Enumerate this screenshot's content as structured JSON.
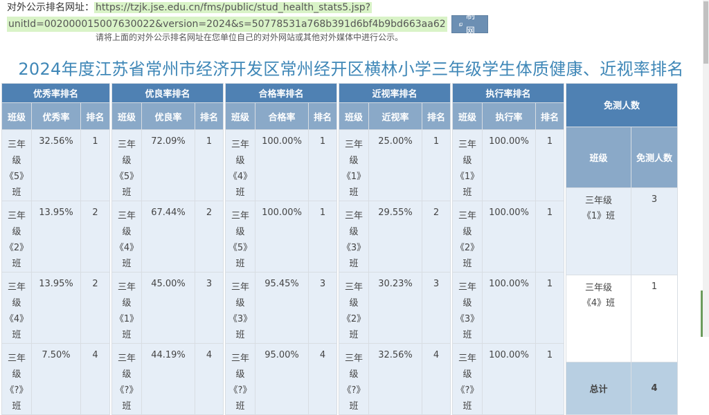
{
  "url_label": "对外公示排名网址：",
  "url_part1": "https://tzjk.jse.edu.cn/fms/public/stud_health_stats5.jsp?",
  "url_part2": "unitId=002000015007630022&version=2024&s=50778531a768b391d6bf4b9bd663aa62",
  "copy_button": "复制网址",
  "hint": "请将上面的对外公示排名网址在您单位自己的对外网站或其他对外媒体中进行公示。",
  "title": "2024年度江苏省常州市经济开发区常州经开区横林小学三年级学生体质健康、近视率排名",
  "colors": {
    "group_header": "#4f81b3",
    "sub_header": "#8aa9c8",
    "cell_bg": "#e6eef7",
    "title": "#3f87b7"
  },
  "tables": [
    {
      "header": "优秀率排名",
      "columns": [
        "班级",
        "优秀率",
        "排名"
      ],
      "rows": [
        {
          "cls": [
            "三年",
            "级",
            "《5》",
            "班"
          ],
          "value": "32.56%",
          "rank": "1"
        },
        {
          "cls": [
            "三年",
            "级",
            "《2》",
            "班"
          ],
          "value": "13.95%",
          "rank": "2"
        },
        {
          "cls": [
            "三年",
            "级",
            "《4》",
            "班"
          ],
          "value": "13.95%",
          "rank": "2"
        },
        {
          "cls": [
            "三年",
            "级",
            "《?》",
            "班"
          ],
          "value": "7.50%",
          "rank": "4"
        }
      ]
    },
    {
      "header": "优良率排名",
      "columns": [
        "班级",
        "优良率",
        "排名"
      ],
      "rows": [
        {
          "cls": [
            "三年",
            "级",
            "《5》",
            "班"
          ],
          "value": "72.09%",
          "rank": "1"
        },
        {
          "cls": [
            "三年",
            "级",
            "《4》",
            "班"
          ],
          "value": "67.44%",
          "rank": "2"
        },
        {
          "cls": [
            "三年",
            "级",
            "《1》",
            "班"
          ],
          "value": "45.00%",
          "rank": "3"
        },
        {
          "cls": [
            "三年",
            "级",
            "《?》",
            "班"
          ],
          "value": "44.19%",
          "rank": "4"
        }
      ]
    },
    {
      "header": "合格率排名",
      "columns": [
        "班级",
        "合格率",
        "排名"
      ],
      "rows": [
        {
          "cls": [
            "三年",
            "级",
            "《4》",
            "班"
          ],
          "value": "100.00%",
          "rank": "1"
        },
        {
          "cls": [
            "三年",
            "级",
            "《5》",
            "班"
          ],
          "value": "100.00%",
          "rank": "1"
        },
        {
          "cls": [
            "三年",
            "级",
            "《3》",
            "班"
          ],
          "value": "95.45%",
          "rank": "3"
        },
        {
          "cls": [
            "三年",
            "级",
            "《?》",
            "班"
          ],
          "value": "95.00%",
          "rank": "4"
        }
      ]
    },
    {
      "header": "近视率排名",
      "columns": [
        "班级",
        "近视率",
        "排名"
      ],
      "rows": [
        {
          "cls": [
            "三年",
            "级",
            "《1》",
            "班"
          ],
          "value": "25.00%",
          "rank": "1"
        },
        {
          "cls": [
            "三年",
            "级",
            "《3》",
            "班"
          ],
          "value": "29.55%",
          "rank": "2"
        },
        {
          "cls": [
            "三年",
            "级",
            "《2》",
            "班"
          ],
          "value": "30.23%",
          "rank": "3"
        },
        {
          "cls": [
            "三年",
            "级",
            "《?》",
            "班"
          ],
          "value": "32.56%",
          "rank": "4"
        }
      ]
    },
    {
      "header": "执行率排名",
      "columns": [
        "班级",
        "执行率",
        "排名"
      ],
      "rows": [
        {
          "cls": [
            "三年",
            "级",
            "《1》",
            "班"
          ],
          "value": "100.00%",
          "rank": "1"
        },
        {
          "cls": [
            "三年",
            "级",
            "《2》",
            "班"
          ],
          "value": "100.00%",
          "rank": "1"
        },
        {
          "cls": [
            "三年",
            "级",
            "《3》",
            "班"
          ],
          "value": "100.00%",
          "rank": "1"
        },
        {
          "cls": [
            "三年",
            "级",
            "《?》",
            "班"
          ],
          "value": "100.00%",
          "rank": "1"
        }
      ]
    }
  ],
  "exempt": {
    "header": "免测人数",
    "columns": [
      "班级",
      "免测人数"
    ],
    "rows": [
      {
        "cls": [
          "三年级",
          "《1》班"
        ],
        "count": "3"
      },
      {
        "cls": [
          "三年级",
          "《4》班"
        ],
        "count": "1"
      }
    ],
    "total_label": "总计",
    "total_value": "4"
  }
}
